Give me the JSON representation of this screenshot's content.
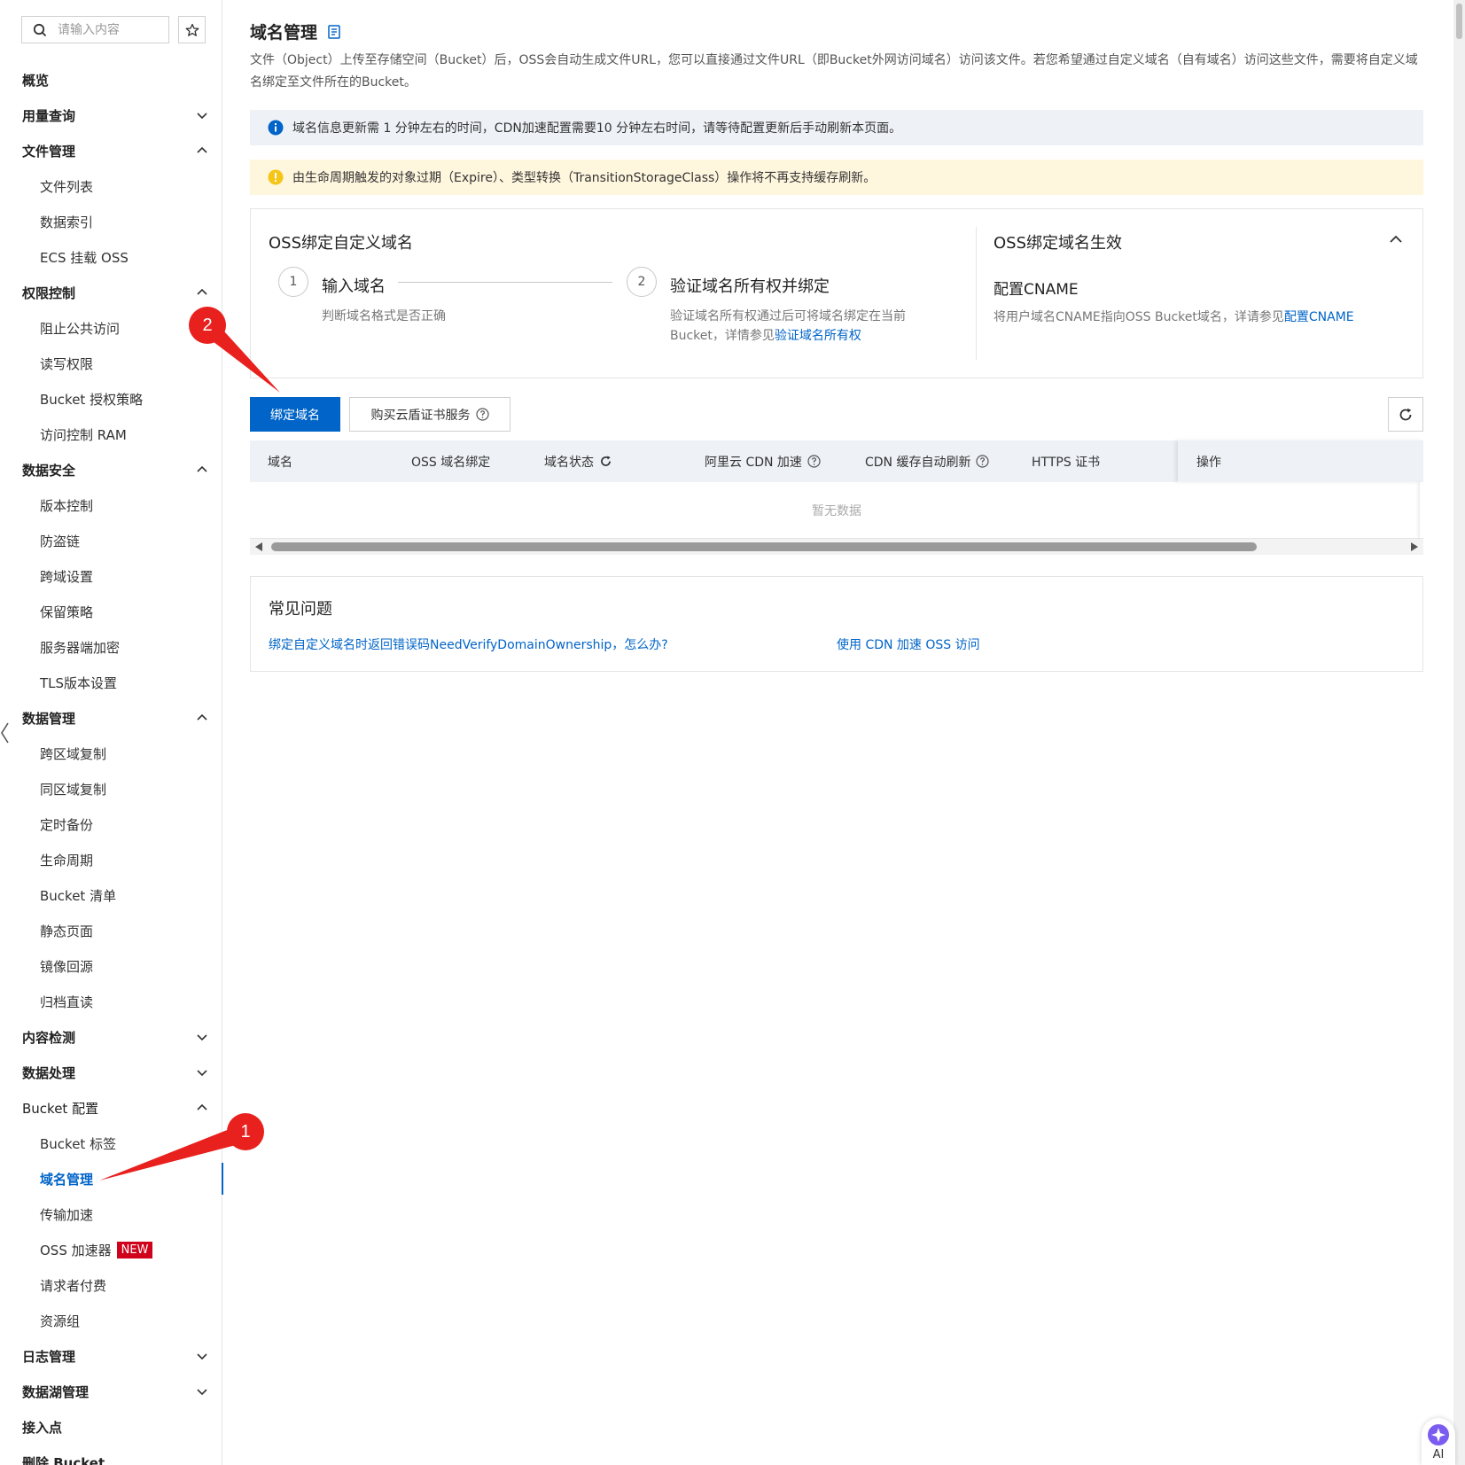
{
  "sidebar": {
    "search_placeholder": "请输入内容",
    "items": [
      {
        "label": "概览",
        "type": "group",
        "chevron": ""
      },
      {
        "label": "用量查询",
        "type": "group",
        "chevron": "down"
      },
      {
        "label": "文件管理",
        "type": "group",
        "chevron": "up"
      },
      {
        "label": "文件列表",
        "type": "child"
      },
      {
        "label": "数据索引",
        "type": "child"
      },
      {
        "label": "ECS 挂载 OSS",
        "type": "child"
      },
      {
        "label": "权限控制",
        "type": "group",
        "chevron": "up"
      },
      {
        "label": "阻止公共访问",
        "type": "child"
      },
      {
        "label": "读写权限",
        "type": "child"
      },
      {
        "label": "Bucket 授权策略",
        "type": "child"
      },
      {
        "label": "访问控制 RAM",
        "type": "child"
      },
      {
        "label": "数据安全",
        "type": "group",
        "chevron": "up"
      },
      {
        "label": "版本控制",
        "type": "child"
      },
      {
        "label": "防盗链",
        "type": "child"
      },
      {
        "label": "跨域设置",
        "type": "child"
      },
      {
        "label": "保留策略",
        "type": "child"
      },
      {
        "label": "服务器端加密",
        "type": "child"
      },
      {
        "label": "TLS版本设置",
        "type": "child"
      },
      {
        "label": "数据管理",
        "type": "group",
        "chevron": "up"
      },
      {
        "label": "跨区域复制",
        "type": "child"
      },
      {
        "label": "同区域复制",
        "type": "child"
      },
      {
        "label": "定时备份",
        "type": "child"
      },
      {
        "label": "生命周期",
        "type": "child"
      },
      {
        "label": "Bucket 清单",
        "type": "child"
      },
      {
        "label": "静态页面",
        "type": "child"
      },
      {
        "label": "镜像回源",
        "type": "child"
      },
      {
        "label": "归档直读",
        "type": "child"
      },
      {
        "label": "内容检测",
        "type": "group",
        "chevron": "down"
      },
      {
        "label": "数据处理",
        "type": "group",
        "chevron": "down"
      },
      {
        "label": "Bucket 配置",
        "type": "group-plain",
        "chevron": "up"
      },
      {
        "label": "Bucket 标签",
        "type": "child"
      },
      {
        "label": "域名管理",
        "type": "child",
        "active": true
      },
      {
        "label": "传输加速",
        "type": "child"
      },
      {
        "label": "OSS 加速器",
        "type": "child",
        "badge": "NEW"
      },
      {
        "label": "请求者付费",
        "type": "child"
      },
      {
        "label": "资源组",
        "type": "child"
      },
      {
        "label": "日志管理",
        "type": "group",
        "chevron": "down"
      },
      {
        "label": "数据湖管理",
        "type": "group",
        "chevron": "down"
      },
      {
        "label": "接入点",
        "type": "group",
        "chevron": ""
      },
      {
        "label": "删除 Bucket",
        "type": "group",
        "chevron": ""
      }
    ]
  },
  "main": {
    "title": "域名管理",
    "description": "文件（Object）上传至存储空间（Bucket）后，OSS会自动生成文件URL，您可以直接通过文件URL（即Bucket外网访问域名）访问该文件。若您希望通过自定义域名（自有域名）访问这些文件，需要将自定义域名绑定至文件所在的Bucket。",
    "info_alert": "域名信息更新需 1 分钟左右的时间，CDN加速配置需要10 分钟左右时间，请等待配置更新后手动刷新本页面。",
    "warn_alert": "由生命周期触发的对象过期（Expire）、类型转换（TransitionStorageClass）操作将不再支持缓存刷新。",
    "steps_card": {
      "title": "OSS绑定自定义域名",
      "step1": {
        "num": "1",
        "title": "输入域名",
        "desc": "判断域名格式是否正确"
      },
      "step2": {
        "num": "2",
        "title": "验证域名所有权并绑定",
        "desc_line1": "验证域名所有权通过后可将域名绑定在当前",
        "desc_line2": "Bucket，详情参见",
        "link": "验证域名所有权"
      },
      "effect_title": "OSS绑定域名生效",
      "cname_title": "配置CNAME",
      "cname_desc": "将用户域名CNAME指向OSS Bucket域名，详请参见",
      "cname_link": "配置CNAME"
    },
    "toolbar": {
      "bind_label": "绑定域名",
      "buy_label": "购买云盾证书服务"
    },
    "table": {
      "columns": [
        "域名",
        "OSS 域名绑定",
        "域名状态",
        "阿里云 CDN 加速",
        "CDN 缓存自动刷新",
        "HTTPS 证书",
        "操作"
      ],
      "empty_text": "暂无数据"
    },
    "faq": {
      "title": "常见问题",
      "links": [
        "绑定自定义域名时返回错误码NeedVerifyDomainOwnership，怎么办?",
        "使用 CDN 加速 OSS 访问"
      ]
    }
  },
  "annotations": {
    "badge1": "1",
    "badge2": "2",
    "accent": "#e8201e"
  },
  "ai_fab_label": "AI",
  "colors": {
    "primary": "#0064c8",
    "info_bg": "#eef1f6",
    "warn_bg": "#fff6de",
    "warn_icon": "#f5c518",
    "new_badge": "#d0021b"
  }
}
